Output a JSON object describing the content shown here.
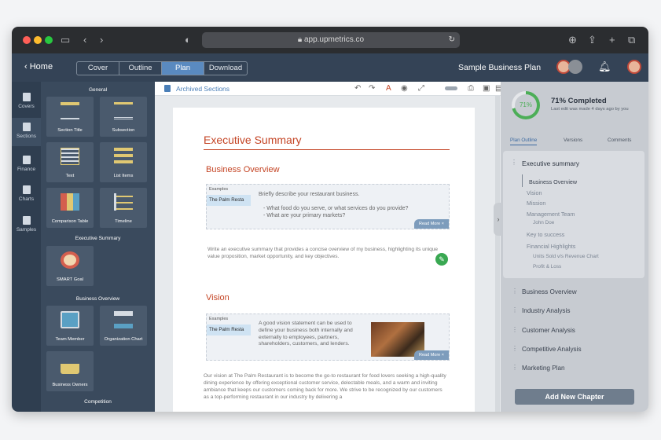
{
  "browser": {
    "url": "app.upmetrics.co"
  },
  "header": {
    "home_label": "Home",
    "tabs": [
      {
        "label": "Cover"
      },
      {
        "label": "Outline"
      },
      {
        "label": "Plan"
      },
      {
        "label": "Download"
      }
    ],
    "plan_title": "Sample Business Plan"
  },
  "rail": {
    "items": [
      {
        "label": "Covers"
      },
      {
        "label": "Sections"
      },
      {
        "label": "Finance"
      },
      {
        "label": "Charts"
      },
      {
        "label": "Samples"
      }
    ]
  },
  "palette": {
    "groups": [
      "General",
      "Executive Summary",
      "Business Overview",
      "Competition"
    ],
    "tiles": [
      {
        "label": "Section Title"
      },
      {
        "label": "Subsection"
      },
      {
        "label": "Text"
      },
      {
        "label": "List Items"
      },
      {
        "label": "Comparison Table"
      },
      {
        "label": "Timeline"
      },
      {
        "label": "SMART Goal"
      },
      {
        "label": "Team Member"
      },
      {
        "label": "Organization Chart"
      },
      {
        "label": "Business Owners"
      }
    ]
  },
  "toolbar": {
    "archived_label": "Archived Sections"
  },
  "doc": {
    "title": "Executive Summary",
    "overview": {
      "heading": "Business Overview",
      "examples_label": "Examples",
      "example_name": "The Palm Resta",
      "prompt": "Briefly describe your restaurant business.",
      "bullets": [
        "- What food do you serve, or what services do you provide?",
        "- What are your primary markets?"
      ],
      "read_more": "Read More",
      "body": "Write an executive summary that provides a concise overview of my business, highlighting its unique value proposition, market opportunity, and key objectives."
    },
    "vision": {
      "heading": "Vision",
      "examples_label": "Examples",
      "example_name": "The Palm Resta",
      "prompt": "A good vision statement can be used to define your business both internally and externally to employees, partners, shareholders, customers, and lenders.",
      "read_more": "Read More",
      "body": "Our vision at The Palm Restaurant is to become the go-to restaurant for food lovers seeking a high-quality dining experience by offering exceptional customer service, delectable meals, and a warm and inviting ambiance that keeps our customers coming back for more. We strive to be recognized by our customers as a top-performing restaurant in our industry by delivering a"
    }
  },
  "right": {
    "progress_pct": 71,
    "progress_label": "71%",
    "completed": "71% Completed",
    "last_edit": "Last edit was made 4 days ago by you",
    "tabs": [
      {
        "label": "Plan Outline"
      },
      {
        "label": "Versions"
      },
      {
        "label": "Comments"
      }
    ],
    "outline_chapter": "Executive summary",
    "outline_items": [
      "Business Overview",
      "Vision",
      "Mission",
      "Management Team",
      "John Doe",
      "Key to success",
      "Financial Highlights",
      "Units Sold v/s Revenue Chart",
      "Profit & Loss"
    ],
    "chapters": [
      "Business Overview",
      "Industry Analysis",
      "Customer Analysis",
      "Competitive Analysis",
      "Marketing Plan"
    ],
    "add_button": "Add New Chapter"
  },
  "colors": {
    "accent": "#c44424",
    "nav": "#344356",
    "active_tab": "#5a8ac0",
    "progress": "#4cae57"
  }
}
